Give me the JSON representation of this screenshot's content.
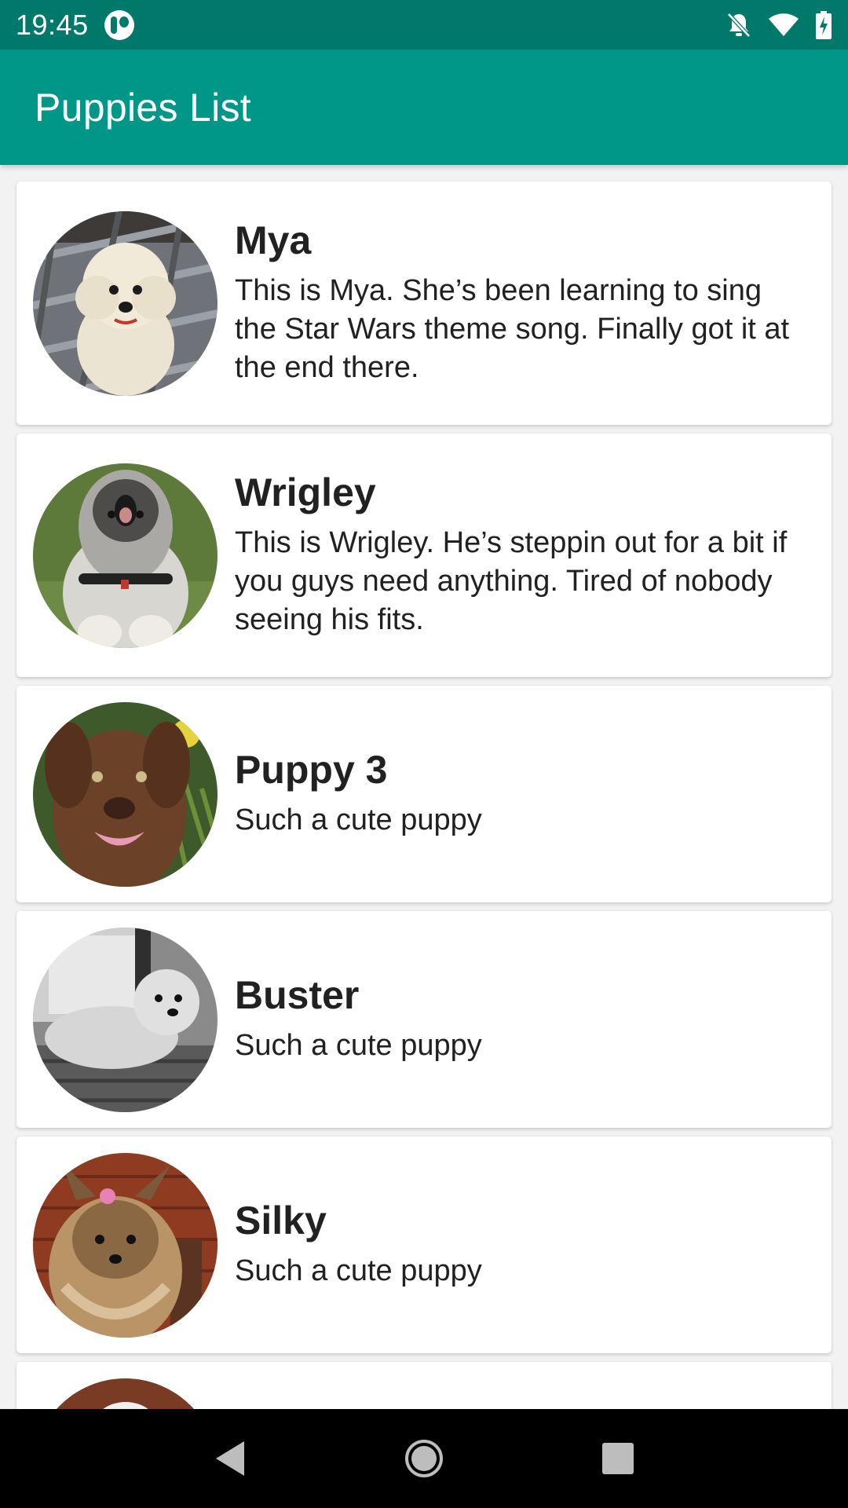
{
  "status_bar": {
    "time": "19:45",
    "icons": [
      "app-notification-icon",
      "do-not-disturb-icon",
      "wifi-icon",
      "battery-charging-icon"
    ]
  },
  "app_bar": {
    "title": "Puppies List"
  },
  "theme": {
    "primary": "#009688",
    "primary_dark": "#00796b",
    "background": "#f2f2f2"
  },
  "puppies": [
    {
      "name": "Mya",
      "description": "This is Mya. She’s been learning to sing the Star Wars theme song. Finally got it at the end there.",
      "avatar": "poodle-photo"
    },
    {
      "name": "Wrigley",
      "description": "This is Wrigley. He’s steppin out for a bit if you guys need anything. Tired of nobody seeing his fits.",
      "avatar": "sheepdog-photo"
    },
    {
      "name": "Puppy 3",
      "description": "Such a cute puppy",
      "avatar": "chocolate-lab-photo"
    },
    {
      "name": "Buster",
      "description": "Such a cute puppy",
      "avatar": "bw-terrier-photo"
    },
    {
      "name": "Silky",
      "description": "Such a cute puppy",
      "avatar": "yorkie-photo"
    },
    {
      "name": "",
      "description": "",
      "avatar": "partial-puppy-photo"
    }
  ],
  "nav_bar": {
    "buttons": [
      "back-icon",
      "home-icon",
      "recents-icon"
    ]
  }
}
